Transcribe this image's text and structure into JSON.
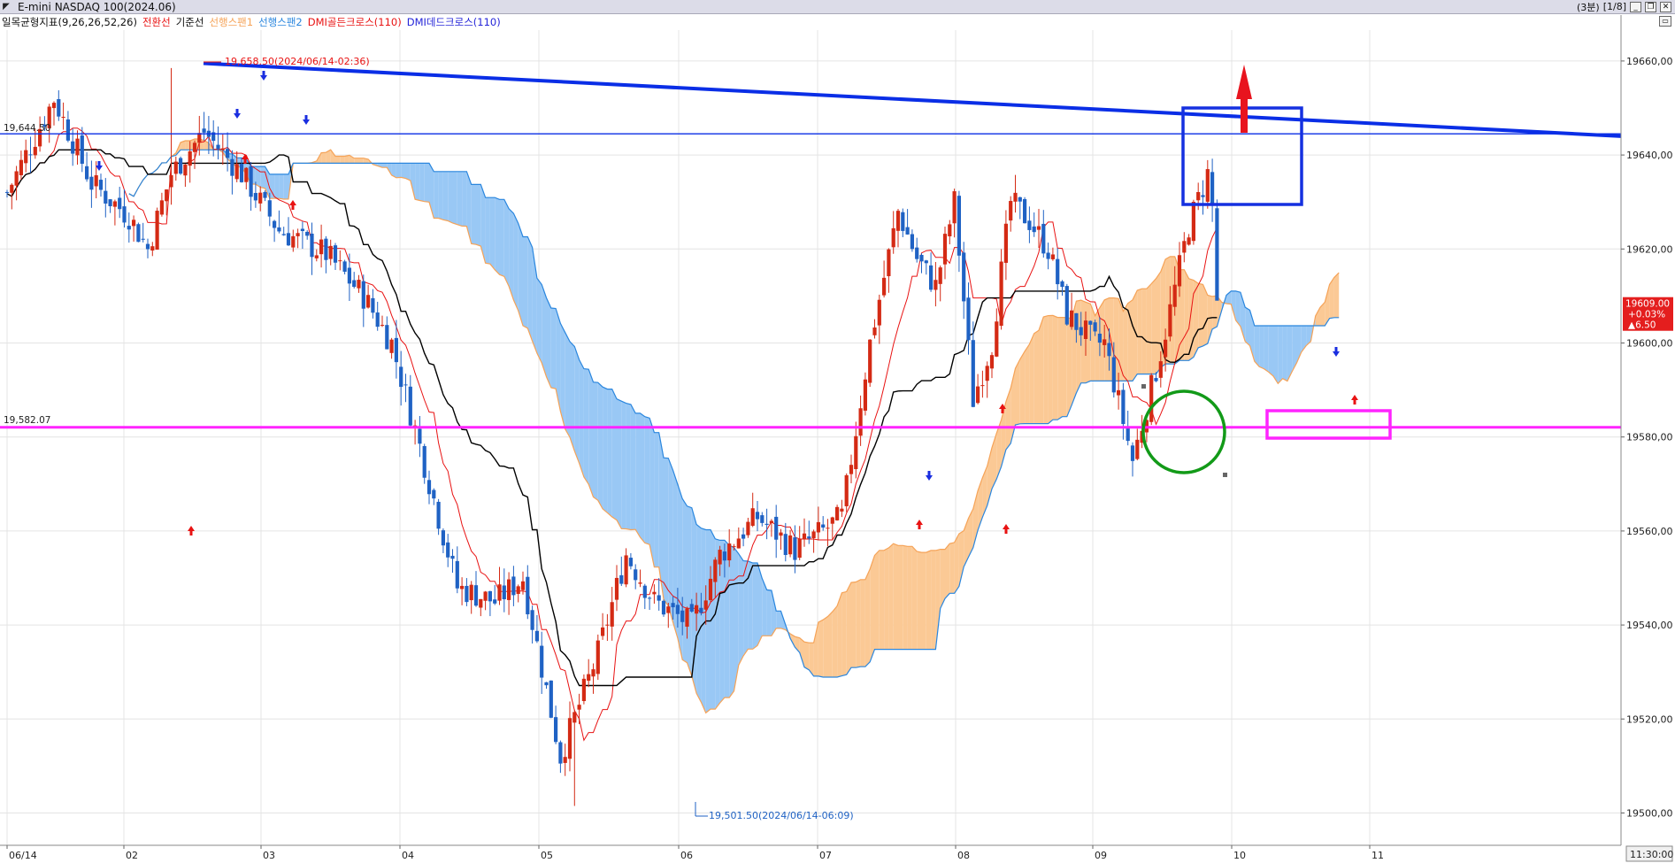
{
  "window": {
    "title": "E-mini NASDAQ 100(2024.06)",
    "menu_icon": "dropdown-triangle-icon",
    "interval": "(3분)",
    "page": "[1/8]",
    "minimize": "_",
    "restore": "❐",
    "close": "✕"
  },
  "legend": {
    "indicator": "일목균형지표(9,26,26,52,26)",
    "tenkan": "전환선",
    "kijun": "기준선",
    "span1": "선행스팬1",
    "span2": "선행스팬2",
    "golden": "DMI골든크로스(110)",
    "dead": "DMI데드크로스(110)"
  },
  "colors": {
    "bull": "#d42a14",
    "bear": "#1f62c4",
    "tenkan": "#e81212",
    "kijun": "#000000",
    "span1": "#f5a358",
    "span2": "#2a86de",
    "cloud_bull": "#fbc995",
    "cloud_bear": "#99c8f5",
    "resistance": "#0a2ee6",
    "support": "#ff24ff",
    "grid": "#e4e4e4"
  },
  "annotations": {
    "high_label": "19,658.50(2024/06/14-02:36)",
    "low_label": "19,501.50(2024/06/14-06:09)",
    "left_label_top": "19,644.50",
    "left_label_mid": "19,582.07",
    "price_now": "19609.00",
    "change_pct": "+0.03%",
    "change_abs": "▲6.50",
    "time_now": "11:30:00"
  },
  "chart_data": {
    "type": "candlestick",
    "y_axis": {
      "ticks": [
        "19660.00",
        "19640.00",
        "19620.00",
        "19600.00",
        "19580.00",
        "19560.00",
        "19540.00",
        "19520.00",
        "19500.00"
      ],
      "ylim": [
        19497,
        19672
      ]
    },
    "x_axis": {
      "ticks": [
        "06/14",
        "02",
        "03",
        "04",
        "05",
        "06",
        "07",
        "08",
        "09",
        "10",
        "11"
      ]
    },
    "high": 19658.5,
    "low": 19501.5,
    "horizontal_lines": [
      19644.5,
      19582.07
    ],
    "trendline": {
      "from": 19659.5,
      "to": 19644.0
    },
    "current": 19609.0
  }
}
